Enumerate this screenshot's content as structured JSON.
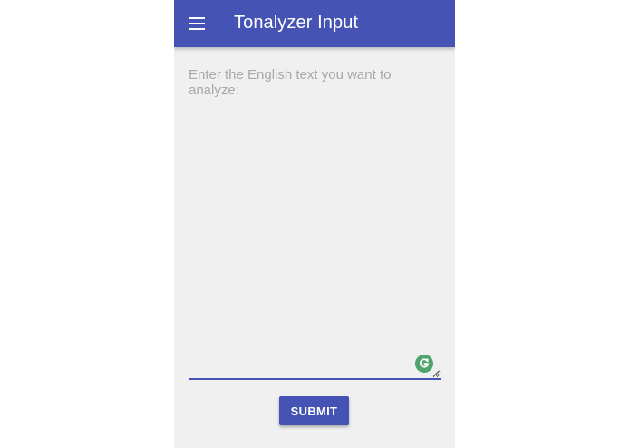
{
  "appbar": {
    "title": "Tonalyzer Input",
    "menu_icon": "hamburger-menu-icon",
    "color": "#4453b4"
  },
  "form": {
    "text_input": {
      "value": "",
      "placeholder": "Enter the English text you want to analyze:"
    },
    "grammarly_icon": "grammarly-icon",
    "submit_label": "SUBMIT"
  },
  "colors": {
    "accent": "#4453b4",
    "background": "#f0f0f0",
    "grammarly": "#4fa36b"
  }
}
